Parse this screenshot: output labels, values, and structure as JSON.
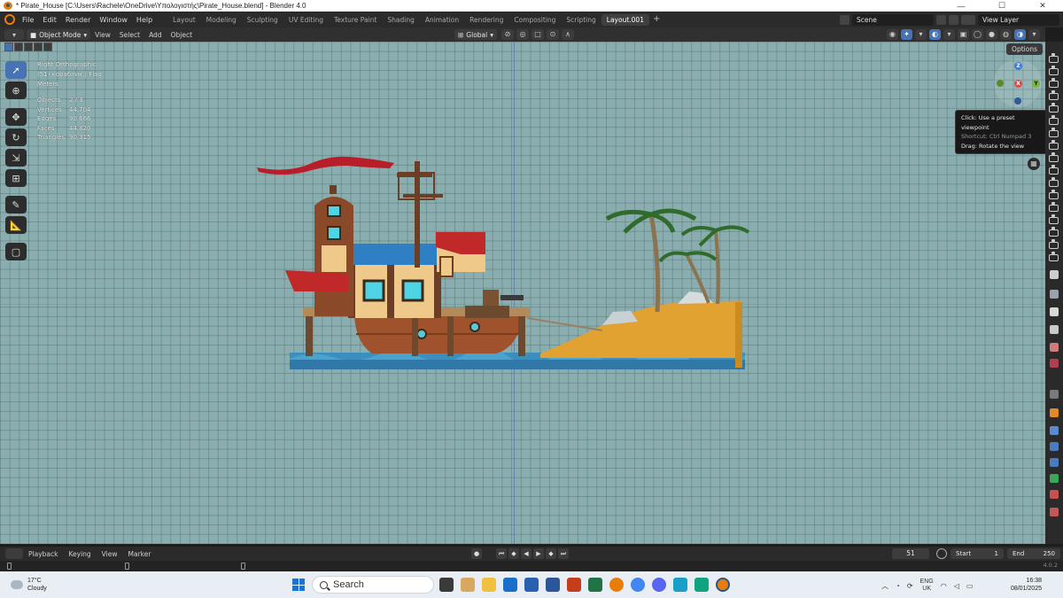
{
  "window": {
    "title": "* Pirate_House [C:\\Users\\Rachele\\OneDrive\\Υπολογιστής\\Pirate_House.blend] - Blender 4.0",
    "minimize": "—",
    "maximize": "☐",
    "close": "✕"
  },
  "menu": {
    "items": [
      "File",
      "Edit",
      "Render",
      "Window",
      "Help"
    ]
  },
  "workspaces": {
    "tabs": [
      "Layout",
      "Modeling",
      "Sculpting",
      "UV Editing",
      "Texture Paint",
      "Shading",
      "Animation",
      "Rendering",
      "Compositing",
      "Scripting",
      "Layout.001"
    ],
    "active": "Layout.001",
    "add": "+"
  },
  "scene": {
    "label": "Scene"
  },
  "view_layer": {
    "label": "View Layer"
  },
  "header": {
    "mode": "Object Mode",
    "menus": [
      "View",
      "Select",
      "Add",
      "Object"
    ],
    "orientation": "Global",
    "options": "Options"
  },
  "viewport": {
    "view_name": "Right Orthographic",
    "collection": "(51) кораблик | Flag",
    "units": "Meters",
    "stats": [
      {
        "label": "Objects",
        "value": "2 / 3"
      },
      {
        "label": "Vertices",
        "value": "44,704"
      },
      {
        "label": "Edges",
        "value": "90,666"
      },
      {
        "label": "Faces",
        "value": "44,820"
      },
      {
        "label": "Triangles",
        "value": "90,315"
      }
    ],
    "background_color": "#8aaeaf"
  },
  "gizmo": {
    "z": "Z",
    "y": "Y",
    "x": "X"
  },
  "tooltip": {
    "line1": "Click: Use a preset viewpoint",
    "line2": "Shortcut: Ctrl Numpad 3",
    "line3": "Drag: Rotate the view"
  },
  "timeline": {
    "menus": [
      "Playback",
      "Keying",
      "View",
      "Marker"
    ],
    "current_frame": "51",
    "start_label": "Start",
    "start_value": "1",
    "end_label": "End",
    "end_value": "250"
  },
  "status": {
    "version": "4.0.2"
  },
  "taskbar": {
    "temperature": "17°C",
    "weather": "Cloudy",
    "search_placeholder": "Search",
    "lang_top": "ENG",
    "lang_bottom": "UK",
    "time": "16:38",
    "date": "08/01/2025"
  }
}
